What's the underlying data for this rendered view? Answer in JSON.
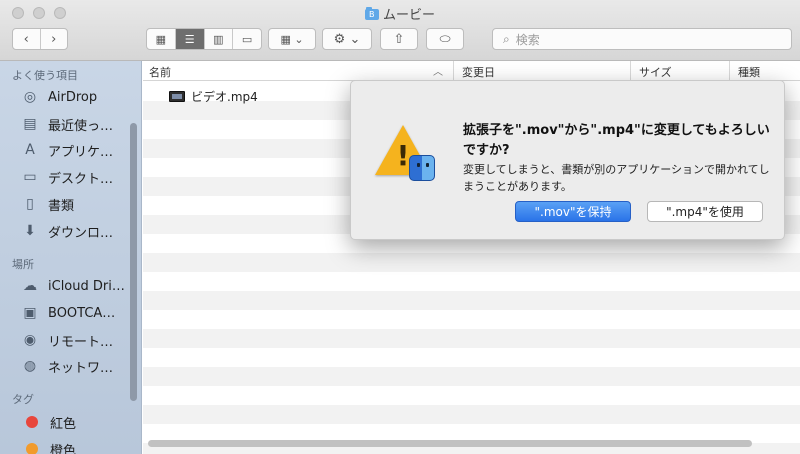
{
  "window": {
    "title": "ムービー",
    "folder_badge": "B"
  },
  "toolbar": {
    "back_icon": "‹",
    "forward_icon": "›",
    "view_modes": [
      "icon-view",
      "list-view",
      "column-view",
      "gallery-view"
    ],
    "arrange_icon": "▦",
    "action_icon": "⚙",
    "chevron_icon": "⌄",
    "share_icon": "⇧",
    "tag_icon": "⬭",
    "search_placeholder": "検索"
  },
  "sidebar": {
    "favorites_heading": "よく使う項目",
    "favorites": [
      {
        "label": "AirDrop",
        "icon": "airdrop-icon",
        "glyph": "◎"
      },
      {
        "label": "最近使っ…",
        "icon": "recents-icon",
        "glyph": "▤"
      },
      {
        "label": "アプリケ…",
        "icon": "applications-icon",
        "glyph": "A"
      },
      {
        "label": "デスクト…",
        "icon": "desktop-icon",
        "glyph": "▭"
      },
      {
        "label": "書類",
        "icon": "documents-icon",
        "glyph": "▯"
      },
      {
        "label": "ダウンロ…",
        "icon": "downloads-icon",
        "glyph": "⬇"
      }
    ],
    "locations_heading": "場所",
    "locations": [
      {
        "label": "iCloud Dri…",
        "icon": "icloud-icon",
        "glyph": "☁"
      },
      {
        "label": "BOOTCA…",
        "icon": "disk-icon",
        "glyph": "▣"
      },
      {
        "label": "リモート…",
        "icon": "remote-disc-icon",
        "glyph": "◉"
      },
      {
        "label": "ネットワ…",
        "icon": "network-icon",
        "glyph": "◍"
      }
    ],
    "tags_heading": "タグ",
    "tags": [
      {
        "label": "紅色",
        "color": "#e8463c"
      },
      {
        "label": "橙色",
        "color": "#f19b2c"
      }
    ]
  },
  "list": {
    "columns": [
      "名前",
      "変更日",
      "サイズ",
      "種類"
    ],
    "sort_indicator": "︿",
    "files": [
      {
        "name": "ビデオ.mp4"
      }
    ]
  },
  "alert": {
    "title": "拡張子を\".mov\"から\".mp4\"に変更してもよろしいですか?",
    "message": "変更してしまうと、書類が別のアプリケーションで開かれてしまうことがあります。",
    "primary_button": "\".mov\"を保持",
    "secondary_button": "\".mp4\"を使用",
    "warning_glyph": "!"
  },
  "colors": {
    "accent": "#2a73e8",
    "sidebar_bg": "#c2d0e2",
    "warning": "#f5b31e"
  }
}
